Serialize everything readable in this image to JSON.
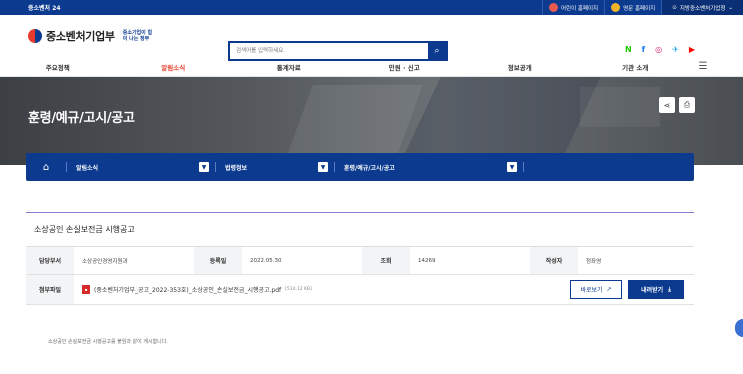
{
  "topbar": {
    "brand": "중소벤처 24",
    "links": [
      {
        "label": "어린이 홈페이지",
        "icon": "kid-icon",
        "color": "#e85a4f"
      },
      {
        "label": "영문 홈페이지",
        "icon": "globe-person-icon",
        "color": "#f0b429"
      },
      {
        "label": "지방중소벤처기업청",
        "icon": "location-pin-icon",
        "color": "#ffffff"
      }
    ]
  },
  "header": {
    "logo_text": "중소벤처기업부",
    "slogan": "중소기업이 힘이 나는 정부",
    "search_placeholder": "검색어를 입력하세요.",
    "social": [
      {
        "label": "N",
        "icon": "naver-icon",
        "color": "#1ec800"
      },
      {
        "label": "f",
        "icon": "facebook-icon",
        "color": "#1877f2"
      },
      {
        "label": "◎",
        "icon": "instagram-icon",
        "color": "#d62976"
      },
      {
        "label": "✈",
        "icon": "twitter-icon",
        "color": "#1da1f2"
      },
      {
        "label": "▶",
        "icon": "youtube-icon",
        "color": "#ff0000"
      }
    ]
  },
  "gnb": {
    "items": [
      "주요정책",
      "알림소식",
      "통계자료",
      "민원 · 신고",
      "정보공개",
      "기관 소개"
    ],
    "active_index": 1
  },
  "hero": {
    "title": "훈령/예규/고시/공고"
  },
  "breadcrumb": {
    "home": "⌂",
    "segments": [
      "알림소식",
      "법령정보",
      "훈령/예규/고시/공고"
    ]
  },
  "post": {
    "title": "소상공인 손실보전금 시행공고",
    "labels": {
      "dept": "담당부서",
      "date": "등록일",
      "views": "조회",
      "author": "작성자",
      "attach": "첨부파일"
    },
    "dept": "소상공인경영지원과",
    "date": "2022.05.30",
    "views": "14269",
    "author": "정좌영",
    "file_name": "(중소벤처기업부_공고_2022-353호)_소상공인_손실보전금_시행공고.pdf",
    "file_size": "[514.12 KB]",
    "view_label": "바로보기",
    "download_label": "내려받기",
    "body": "소상공인 손실보전금 시행공고를 붙임과 같이 게시합니다."
  }
}
